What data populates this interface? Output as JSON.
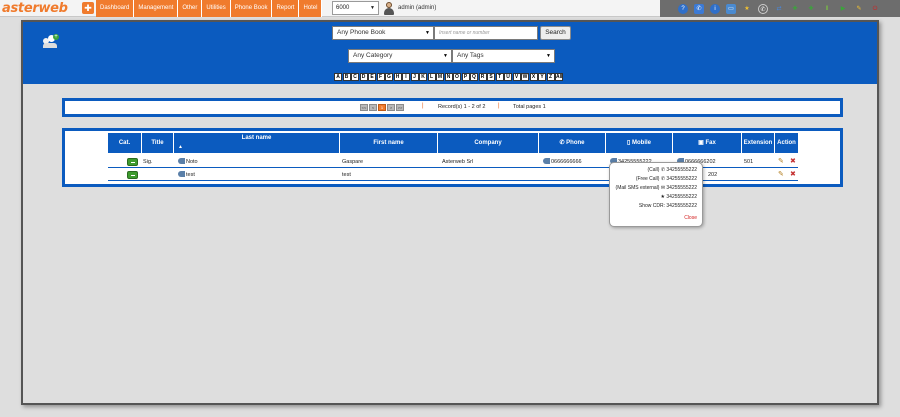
{
  "app": {
    "logo_text": "asterweb",
    "nav": [
      "Dashboard",
      "Management",
      "Other",
      "Utilities",
      "Phone Book",
      "Report",
      "Hotel"
    ],
    "extension_value": "6000",
    "user_label": "admin (admin)",
    "toolbar_icons": [
      "help-icon",
      "phone-icon",
      "info-icon",
      "monitor-icon",
      "star-icon",
      "dialer-icon",
      "transfer-icon",
      "queue-icon",
      "agent-icon",
      "pause-icon",
      "play-icon",
      "wrench-icon",
      "logout-icon"
    ]
  },
  "filters": {
    "phone_book": "Any Phone Book",
    "search_placeholder": "Insert name or number",
    "search_button": "Search",
    "category": "Any Category",
    "tags": "Any Tags",
    "letters": [
      "A",
      "B",
      "C",
      "D",
      "E",
      "F",
      "G",
      "H",
      "I",
      "J",
      "K",
      "L",
      "M",
      "N",
      "O",
      "P",
      "Q",
      "R",
      "S",
      "T",
      "U",
      "V",
      "W",
      "X",
      "Y",
      "Z",
      "All"
    ]
  },
  "pager": {
    "buttons": [
      "<<",
      "<",
      "1",
      ">",
      ">>"
    ],
    "current": "1",
    "records": "Record(s) 1 - 2 of 2",
    "total": "Total pages 1"
  },
  "table": {
    "headers": {
      "cat": "Cat.",
      "title": "Title",
      "last_name": "Last name",
      "first_name": "First name",
      "company": "Company",
      "phone": "Phone",
      "mobile": "Mobile",
      "fax": "Fax",
      "extension": "Extension",
      "action": "Action"
    },
    "sort_indicator": "▲",
    "rows": [
      {
        "title": "Sig.",
        "last_name": "Noto",
        "first_name": "Gaspare",
        "company": "Asterweb Srl",
        "phone": "0666666666",
        "mobile": "34255555222",
        "fax": "0666666202",
        "extension": "501"
      },
      {
        "title": "",
        "last_name": "test",
        "first_name": "test",
        "company": "",
        "phone": "",
        "mobile": "",
        "fax": "202",
        "extension": ""
      }
    ]
  },
  "popup": {
    "call": "(Call) ✆ 34255555222",
    "free_call": "(Free Call) ✆ 34255555222",
    "mail_sms": "(Mail SMS external) ✉ 34255555222",
    "star": "★ 34255555222",
    "show_cdr": "Show CDR: 34255555222",
    "close": "Close"
  },
  "colors": {
    "accent": "#f07b2d",
    "header_blue": "#0b5bbf",
    "background": "#dedede"
  }
}
